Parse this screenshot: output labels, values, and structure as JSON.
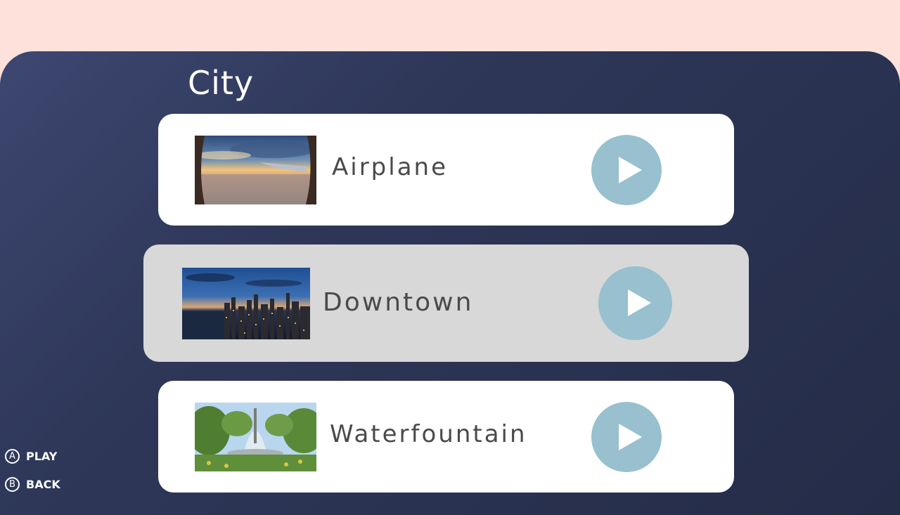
{
  "category": {
    "title": "City"
  },
  "tracks": [
    {
      "label": "Airplane",
      "image": "airplane-window-photo",
      "icon": "play-icon",
      "selected": false
    },
    {
      "label": "Downtown",
      "image": "city-skyline-photo",
      "icon": "play-icon",
      "selected": true
    },
    {
      "label": "Waterfountain",
      "image": "water-fountain-photo",
      "icon": "play-icon",
      "selected": false
    }
  ],
  "hints": [
    {
      "button": "A",
      "label": "PLAY"
    },
    {
      "button": "B",
      "label": "BACK"
    }
  ],
  "colors": {
    "top_background": "#fde1da",
    "panel": "#2e3758",
    "card": "#ffffff",
    "card_selected": "#d8d8d8",
    "play_button": "#98c0cf",
    "label_text": "#4a4a4a"
  }
}
